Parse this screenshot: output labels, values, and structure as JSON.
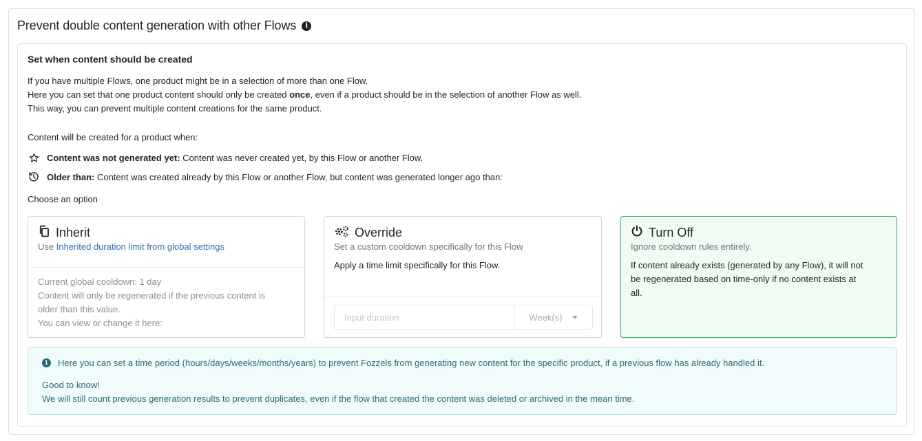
{
  "header": {
    "title": "Prevent double content generation with other Flows"
  },
  "section": {
    "title": "Set when content should be created",
    "intro": {
      "line1": "If you have multiple Flows, one product might be in a selection of more than one Flow.",
      "line2_pre": "Here you can set that one product content should only be created ",
      "line2_bold": "once",
      "line2_post": ", even if a product should be in the selection of another Flow as well.",
      "line3": "This way, you can prevent multiple content creations for the same product."
    },
    "condition_intro": "Content will be created for a product when:",
    "rules": [
      {
        "icon": "star-icon",
        "bold": "Content was not generated yet:",
        "text": " Content was never created yet, by this Flow or another Flow."
      },
      {
        "icon": "history-icon",
        "bold": "Older than:",
        "text": " Content was created already by this Flow or another Flow, but content was generated longer ago than:"
      }
    ],
    "choose_label": "Choose an option"
  },
  "options": {
    "inherit": {
      "icon": "copy-icon",
      "title": "Inherit",
      "sub_pre": "Use ",
      "sub_link": "Inherited duration limit from global settings",
      "line1": "Current global cooldown: 1 day",
      "line2": "Content will only be regenerated if the previous content is",
      "line3": "older than this value.",
      "line4": "You can view or change it here:"
    },
    "override": {
      "icon": "gears-icon",
      "title": "Override",
      "sub": "Set a custom cooldown specifically for this Flow",
      "body": "Apply a time limit specifically for this Flow.",
      "input_placeholder": "Input duration",
      "unit_selected": "Week(s)"
    },
    "turn_off": {
      "icon": "power-icon",
      "title": "Turn Off",
      "sub": "Ignore cooldown rules entirely.",
      "line1": "If content already exists (generated by any Flow), it will not",
      "line2": "be regenerated based on time-only if no content exists at",
      "line3": "all.",
      "selected_border_color": "#2fb36b"
    }
  },
  "alert": {
    "line1": "Here you can set a time period (hours/days/weeks/months/years) to prevent Fozzels from generating new content for the specific product, if a previous flow has already handled it.",
    "good_to_know": "Good to know!",
    "line3": "We will still count previous generation results to prevent duplicates, even if the flow that created the content was deleted or archived in the mean time."
  }
}
